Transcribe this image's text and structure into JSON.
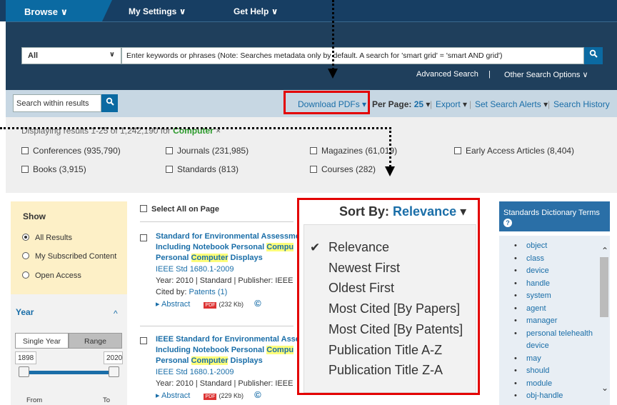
{
  "nav": {
    "browse": "Browse",
    "settings": "My Settings",
    "help": "Get Help",
    "chevron": "∨"
  },
  "search": {
    "scope": "All",
    "keyword_text": "Enter keywords or phrases (Note: Searches metadata only by default. A search for 'smart grid' = 'smart AND grid')",
    "search_icon": "search-icon",
    "advanced": "Advanced Search",
    "divider": "|",
    "other": "Other Search Options"
  },
  "toolbar": {
    "within": "Search within results",
    "download": "Download PDFs",
    "per_page_label": "Per Page:",
    "per_page_value": "25",
    "export": "Export",
    "alerts": "Set Search Alerts",
    "history": "Search History",
    "sep": "|"
  },
  "filters": {
    "displaying": "Displaying results 1-25 of 1,242,190 for",
    "query": "Computer",
    "clear": "×",
    "items": [
      "Conferences (935,790)",
      "Journals (231,985)",
      "Magazines (61,019)",
      "Early Access Articles (8,404)",
      "Books (3,915)",
      "Standards (813)",
      "Courses (282)"
    ]
  },
  "sidebar": {
    "show": "Show",
    "options": [
      "All Results",
      "My Subscribed Content",
      "Open Access"
    ],
    "year": "Year",
    "year_chevron": "^",
    "single": "Single Year",
    "range": "Range",
    "min": "1898",
    "max": "2020",
    "from": "From",
    "to": "To"
  },
  "results": {
    "select_all": "Select All on Page",
    "items": [
      {
        "t1": "Standard for Environmental Assessment",
        "t2a": "Including Notebook Personal ",
        "t2b": "Compu",
        "t3a": "Personal ",
        "t3b": "Computer",
        "t3c": " Displays",
        "id": "IEEE Std 1680.1-2009",
        "meta": "Year: 2010 | Standard | Publisher: IEEE",
        "cited_label": "Cited by:",
        "cited": "Patents (1)",
        "abstract": "Abstract",
        "pdf": "PDF",
        "size": "(232 Kb)",
        "c": "©"
      },
      {
        "t1": "IEEE Standard for Environmental Asses",
        "t2a": "Including Notebook Personal ",
        "t2b": "Compu",
        "t3a": "Personal ",
        "t3b": "Computer",
        "t3c": " Displays",
        "id": "IEEE Std 1680.1-2009",
        "meta": "Year: 2010 | Standard | Publisher: IEEE",
        "abstract": "Abstract",
        "pdf": "PDF",
        "size": "(229 Kb)",
        "c": "©"
      }
    ]
  },
  "sort": {
    "label": "Sort By:",
    "value": "Relevance",
    "check": "✔",
    "options": [
      "Relevance",
      "Newest First",
      "Oldest First",
      "Most Cited [By Papers]",
      "Most Cited [By Patents]",
      "Publication Title A-Z",
      "Publication Title Z-A"
    ]
  },
  "dictionary": {
    "title": "Standards Dictionary Terms",
    "help": "?",
    "terms": [
      "object",
      "class",
      "device",
      "handle",
      "system",
      "agent",
      "manager",
      "personal telehealth",
      "device",
      "may",
      "should",
      "module",
      "obj-handle"
    ]
  },
  "colors": {
    "brand": "#0b6aa2",
    "nav": "#173e63",
    "highlight": "#e30000"
  }
}
